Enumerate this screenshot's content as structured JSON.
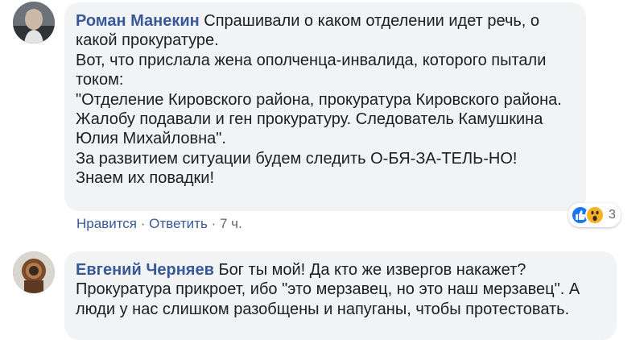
{
  "comments": [
    {
      "author": "Роман Манекин",
      "lines": [
        "Спрашивали о каком отделении идет речь, о",
        "какой прокуратуре.",
        "Вот, что прислала жена ополченца-инвалида, которого пытали",
        "током:",
        "\"Отделение Кировского района, прокуратура Кировского района.",
        "Жалобу подавали и ген прокуратуру. Следователь Камушкина",
        "Юлия Михайловна\".",
        "За развитием ситуации будем следить О-БЯ-ЗА-ТЕЛЬ-НО!",
        "Знаем их повадки!"
      ],
      "actions": {
        "like_label": "Нравится",
        "reply_label": "Ответить",
        "separator": "·",
        "time": "7 ч."
      },
      "reactions": {
        "icons": [
          "like-icon",
          "wow-icon"
        ],
        "count": "3"
      }
    },
    {
      "author": "Евгений Черняев",
      "lines": [
        "Бог ты мой! Да кто же извергов накажет?",
        "Прокуратура прикроет, ибо \"это мерзавец, но это наш мерзавец\". А",
        "люди у нас слишком разобщены и напуганы, чтобы протестовать."
      ]
    }
  ]
}
